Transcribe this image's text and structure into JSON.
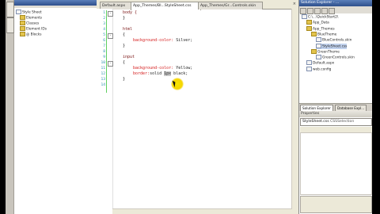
{
  "outline": {
    "items": [
      {
        "label": "Style Sheet",
        "icon": "stylesheet-icon",
        "indent": 0,
        "expander": "-"
      },
      {
        "label": "Elements",
        "icon": "folder-icon",
        "indent": 1,
        "expander": "+"
      },
      {
        "label": "Classes",
        "icon": "folder-icon",
        "indent": 1,
        "expander": ""
      },
      {
        "label": "Element IDs",
        "icon": "folder-icon",
        "indent": 1,
        "expander": ""
      },
      {
        "label": "@ Blocks",
        "icon": "folder-icon",
        "indent": 1,
        "expander": ""
      }
    ]
  },
  "editor": {
    "tabs": [
      {
        "label": "Default.aspx",
        "active": false
      },
      {
        "label": "App_Themes/Bl...StyleSheet.css",
        "active": true
      },
      {
        "label": "App_Themes/Gr...Controls.skin",
        "active": false
      }
    ],
    "close_glyph": "×",
    "line_numbers": [
      "1",
      "2",
      "3",
      "4",
      "5",
      "6",
      "7",
      "8",
      "9",
      "10",
      "11",
      "12",
      "13",
      "14"
    ],
    "code": {
      "l1": "body {",
      "l2": "}",
      "l4": "html",
      "l5": "{",
      "l6_prop": "background-color:",
      "l6_val": " Silver;",
      "l7": "}",
      "l9": "input",
      "l10": "{",
      "l11_prop": "background-color:",
      "l11_val": " Yellow;",
      "l12_prop": "border:",
      "l12_val_a": "solid ",
      "l12_val_b": "1px",
      "l12_val_c": " black;",
      "l13": "}"
    }
  },
  "solution": {
    "title": "Solution Explorer - ...",
    "items": [
      {
        "label": "C:\\...\\QuickStart2\\",
        "indent": 0,
        "icon": "project-icon"
      },
      {
        "label": "App_Data",
        "indent": 1,
        "icon": "folder-icon"
      },
      {
        "label": "App_Themes",
        "indent": 1,
        "icon": "folder-icon"
      },
      {
        "label": "BlueTheme",
        "indent": 2,
        "icon": "folder-icon"
      },
      {
        "label": "BlueControls.skin",
        "indent": 3,
        "icon": "file-icon"
      },
      {
        "label": "StyleSheet.css",
        "indent": 3,
        "icon": "file-icon",
        "selected": true
      },
      {
        "label": "GreenTheme",
        "indent": 2,
        "icon": "folder-icon"
      },
      {
        "label": "GreenControls.skin",
        "indent": 3,
        "icon": "file-icon"
      },
      {
        "label": "Default.aspx",
        "indent": 1,
        "icon": "file-icon"
      },
      {
        "label": "web.config",
        "indent": 1,
        "icon": "file-icon"
      }
    ],
    "tabs": [
      "Solution Explorer",
      "Database Expl..."
    ]
  },
  "properties": {
    "title": "Properties",
    "object": "StyleSheet.css",
    "object_type": "CSSSelection"
  }
}
